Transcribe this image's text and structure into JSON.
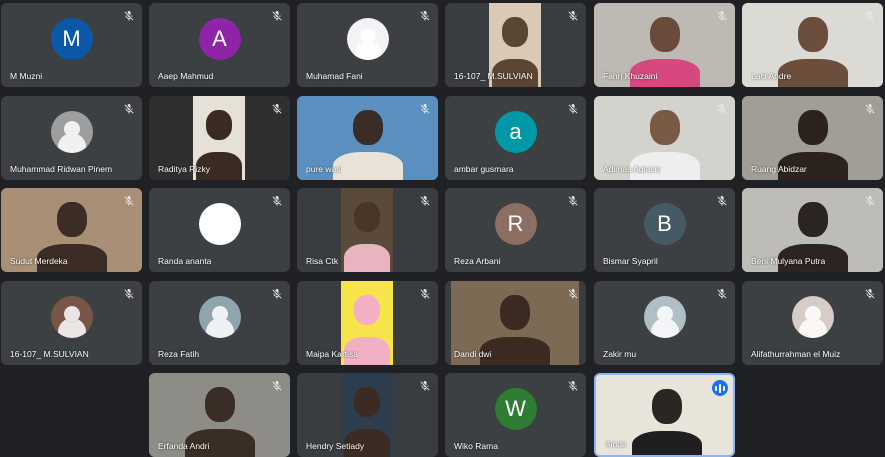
{
  "participants": [
    {
      "name": "M Muzni",
      "type": "initial",
      "initial": "M",
      "color": "#0b57a8"
    },
    {
      "name": "Aaep Mahmud",
      "type": "initial",
      "initial": "A",
      "color": "#8e24aa"
    },
    {
      "name": "Muhamad Fani",
      "type": "photo",
      "color": "#f1f3f4"
    },
    {
      "name": "16-107_ M.SULVIAN",
      "type": "video"
    },
    {
      "name": "Fahri Khuzaini",
      "type": "video"
    },
    {
      "name": "Laci Andre",
      "type": "video"
    },
    {
      "name": "Muhammad Ridwan Pinem",
      "type": "photo",
      "color": "#9e9e9e"
    },
    {
      "name": "Raditya Rizky",
      "type": "video"
    },
    {
      "name": "pure wasi",
      "type": "video"
    },
    {
      "name": "ambar gusmara",
      "type": "initial",
      "initial": "a",
      "color": "#0097a7"
    },
    {
      "name": "Adimas Aglasia",
      "type": "video"
    },
    {
      "name": "Ruang Abidzar",
      "type": "video"
    },
    {
      "name": "Sudut Merdeka",
      "type": "video"
    },
    {
      "name": "Randa ananta",
      "type": "photo",
      "color": "#ffffff"
    },
    {
      "name": "Risa Ctk",
      "type": "video"
    },
    {
      "name": "Reza Arbani",
      "type": "initial",
      "initial": "R",
      "color": "#8d6e63"
    },
    {
      "name": "Bismar Syapril",
      "type": "initial",
      "initial": "B",
      "color": "#455a64"
    },
    {
      "name": "Beni Mulyana Putra",
      "type": "video"
    },
    {
      "name": "16-107_ M.SULVIAN",
      "type": "photo",
      "color": "#795548"
    },
    {
      "name": "Reza Fatih",
      "type": "photo",
      "color": "#90a4ae"
    },
    {
      "name": "Maipa Kartisa",
      "type": "video"
    },
    {
      "name": "Dandi dwi",
      "type": "video"
    },
    {
      "name": "Zakir mu",
      "type": "photo",
      "color": "#b0bec5"
    },
    {
      "name": "Alifathurrahman el Muiz",
      "type": "photo",
      "color": "#d7ccc8"
    },
    {
      "name": "Erfanda Andri",
      "type": "video"
    },
    {
      "name": "Hendry Setiady",
      "type": "video"
    },
    {
      "name": "Wiko Rama",
      "type": "initial",
      "initial": "W",
      "color": "#2e7d32"
    },
    {
      "name": "Ainda",
      "type": "video",
      "speaking": true
    }
  ],
  "colors": {
    "background": "#202124",
    "tile": "#3c4043",
    "speaking_border": "#8ab4f8",
    "speaking_badge": "#1a73e8"
  },
  "icons": {
    "muted": "mic-off-icon",
    "speaking": "audio-level-icon"
  }
}
